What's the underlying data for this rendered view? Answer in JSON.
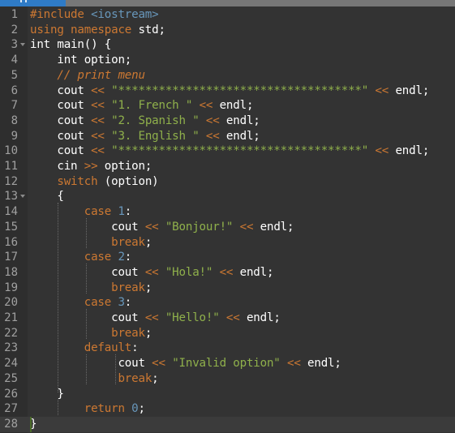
{
  "tabbar": {
    "active_tab_color": "#2f7bc6",
    "inactive_color": "#777777"
  },
  "editor": {
    "language": "C++",
    "background": "#333333",
    "active_line": 28,
    "lines": [
      {
        "n": "1",
        "fold": false,
        "tokens": [
          {
            "t": "pp",
            "v": "#include "
          },
          {
            "t": "inc",
            "v": "<iostream>"
          }
        ]
      },
      {
        "n": "2",
        "fold": false,
        "tokens": [
          {
            "t": "kw",
            "v": "using namespace "
          },
          {
            "t": "id",
            "v": "std;"
          }
        ]
      },
      {
        "n": "3",
        "fold": true,
        "tokens": [
          {
            "t": "id",
            "v": "int main() {"
          }
        ]
      },
      {
        "n": "4",
        "fold": false,
        "tokens": [
          {
            "t": "id",
            "v": "    int option;"
          }
        ]
      },
      {
        "n": "5",
        "fold": false,
        "tokens": [
          {
            "t": "id",
            "v": "    "
          },
          {
            "t": "cm",
            "v": "// print menu"
          }
        ]
      },
      {
        "n": "6",
        "fold": false,
        "tokens": [
          {
            "t": "id",
            "v": "    cout "
          },
          {
            "t": "op",
            "v": "<<"
          },
          {
            "t": "id",
            "v": " "
          },
          {
            "t": "str",
            "v": "\"************************************\""
          },
          {
            "t": "id",
            "v": " "
          },
          {
            "t": "op",
            "v": "<<"
          },
          {
            "t": "id",
            "v": " endl;"
          }
        ]
      },
      {
        "n": "7",
        "fold": false,
        "tokens": [
          {
            "t": "id",
            "v": "    cout "
          },
          {
            "t": "op",
            "v": "<<"
          },
          {
            "t": "id",
            "v": " "
          },
          {
            "t": "str",
            "v": "\"1. French \""
          },
          {
            "t": "id",
            "v": " "
          },
          {
            "t": "op",
            "v": "<<"
          },
          {
            "t": "id",
            "v": " endl;"
          }
        ]
      },
      {
        "n": "8",
        "fold": false,
        "tokens": [
          {
            "t": "id",
            "v": "    cout "
          },
          {
            "t": "op",
            "v": "<<"
          },
          {
            "t": "id",
            "v": " "
          },
          {
            "t": "str",
            "v": "\"2. Spanish \""
          },
          {
            "t": "id",
            "v": " "
          },
          {
            "t": "op",
            "v": "<<"
          },
          {
            "t": "id",
            "v": " endl;"
          }
        ]
      },
      {
        "n": "9",
        "fold": false,
        "tokens": [
          {
            "t": "id",
            "v": "    cout "
          },
          {
            "t": "op",
            "v": "<<"
          },
          {
            "t": "id",
            "v": " "
          },
          {
            "t": "str",
            "v": "\"3. English \""
          },
          {
            "t": "id",
            "v": " "
          },
          {
            "t": "op",
            "v": "<<"
          },
          {
            "t": "id",
            "v": " endl;"
          }
        ]
      },
      {
        "n": "10",
        "fold": false,
        "tokens": [
          {
            "t": "id",
            "v": "    cout "
          },
          {
            "t": "op",
            "v": "<<"
          },
          {
            "t": "id",
            "v": " "
          },
          {
            "t": "str",
            "v": "\"************************************\""
          },
          {
            "t": "id",
            "v": " "
          },
          {
            "t": "op",
            "v": "<<"
          },
          {
            "t": "id",
            "v": " endl;"
          }
        ]
      },
      {
        "n": "11",
        "fold": false,
        "tokens": [
          {
            "t": "id",
            "v": "    cin "
          },
          {
            "t": "op",
            "v": ">>"
          },
          {
            "t": "id",
            "v": " option;"
          }
        ]
      },
      {
        "n": "12",
        "fold": false,
        "tokens": [
          {
            "t": "id",
            "v": "    "
          },
          {
            "t": "kw",
            "v": "switch"
          },
          {
            "t": "id",
            "v": " (option)"
          }
        ]
      },
      {
        "n": "13",
        "fold": true,
        "tokens": [
          {
            "t": "id",
            "v": "    {"
          }
        ]
      },
      {
        "n": "14",
        "fold": false,
        "tokens": [
          {
            "t": "id",
            "v": "        "
          },
          {
            "t": "kw",
            "v": "case "
          },
          {
            "t": "num",
            "v": "1"
          },
          {
            "t": "id",
            "v": ":"
          }
        ]
      },
      {
        "n": "15",
        "fold": false,
        "tokens": [
          {
            "t": "id",
            "v": "            cout "
          },
          {
            "t": "op",
            "v": "<<"
          },
          {
            "t": "id",
            "v": " "
          },
          {
            "t": "str",
            "v": "\"Bonjour!\""
          },
          {
            "t": "id",
            "v": " "
          },
          {
            "t": "op",
            "v": "<<"
          },
          {
            "t": "id",
            "v": " endl;"
          }
        ]
      },
      {
        "n": "16",
        "fold": false,
        "tokens": [
          {
            "t": "id",
            "v": "            "
          },
          {
            "t": "kw",
            "v": "break"
          },
          {
            "t": "id",
            "v": ";"
          }
        ]
      },
      {
        "n": "17",
        "fold": false,
        "tokens": [
          {
            "t": "id",
            "v": "        "
          },
          {
            "t": "kw",
            "v": "case "
          },
          {
            "t": "num",
            "v": "2"
          },
          {
            "t": "id",
            "v": ":"
          }
        ]
      },
      {
        "n": "18",
        "fold": false,
        "tokens": [
          {
            "t": "id",
            "v": "            cout "
          },
          {
            "t": "op",
            "v": "<<"
          },
          {
            "t": "id",
            "v": " "
          },
          {
            "t": "str",
            "v": "\"Hola!\""
          },
          {
            "t": "id",
            "v": " "
          },
          {
            "t": "op",
            "v": "<<"
          },
          {
            "t": "id",
            "v": " endl;"
          }
        ]
      },
      {
        "n": "19",
        "fold": false,
        "tokens": [
          {
            "t": "id",
            "v": "            "
          },
          {
            "t": "kw",
            "v": "break"
          },
          {
            "t": "id",
            "v": ";"
          }
        ]
      },
      {
        "n": "20",
        "fold": false,
        "tokens": [
          {
            "t": "id",
            "v": "        "
          },
          {
            "t": "kw",
            "v": "case "
          },
          {
            "t": "num",
            "v": "3"
          },
          {
            "t": "id",
            "v": ":"
          }
        ]
      },
      {
        "n": "21",
        "fold": false,
        "tokens": [
          {
            "t": "id",
            "v": "            cout "
          },
          {
            "t": "op",
            "v": "<<"
          },
          {
            "t": "id",
            "v": " "
          },
          {
            "t": "str",
            "v": "\"Hello!\""
          },
          {
            "t": "id",
            "v": " "
          },
          {
            "t": "op",
            "v": "<<"
          },
          {
            "t": "id",
            "v": " endl;"
          }
        ]
      },
      {
        "n": "22",
        "fold": false,
        "tokens": [
          {
            "t": "id",
            "v": "            "
          },
          {
            "t": "kw",
            "v": "break"
          },
          {
            "t": "id",
            "v": ";"
          }
        ]
      },
      {
        "n": "23",
        "fold": false,
        "tokens": [
          {
            "t": "id",
            "v": "        "
          },
          {
            "t": "kw",
            "v": "default"
          },
          {
            "t": "id",
            "v": ":"
          }
        ]
      },
      {
        "n": "24",
        "fold": false,
        "tokens": [
          {
            "t": "id",
            "v": "             cout "
          },
          {
            "t": "op",
            "v": "<<"
          },
          {
            "t": "id",
            "v": " "
          },
          {
            "t": "str",
            "v": "\"Invalid option\""
          },
          {
            "t": "id",
            "v": " "
          },
          {
            "t": "op",
            "v": "<<"
          },
          {
            "t": "id",
            "v": " endl;"
          }
        ]
      },
      {
        "n": "25",
        "fold": false,
        "tokens": [
          {
            "t": "id",
            "v": "             "
          },
          {
            "t": "kw",
            "v": "break"
          },
          {
            "t": "id",
            "v": ";"
          }
        ]
      },
      {
        "n": "26",
        "fold": false,
        "tokens": [
          {
            "t": "id",
            "v": "    }"
          }
        ]
      },
      {
        "n": "27",
        "fold": false,
        "tokens": [
          {
            "t": "id",
            "v": "        "
          },
          {
            "t": "kw",
            "v": "return "
          },
          {
            "t": "num",
            "v": "0"
          },
          {
            "t": "id",
            "v": ";"
          }
        ]
      },
      {
        "n": "28",
        "fold": false,
        "tokens": [
          {
            "t": "id",
            "v": "}"
          }
        ]
      }
    ]
  }
}
